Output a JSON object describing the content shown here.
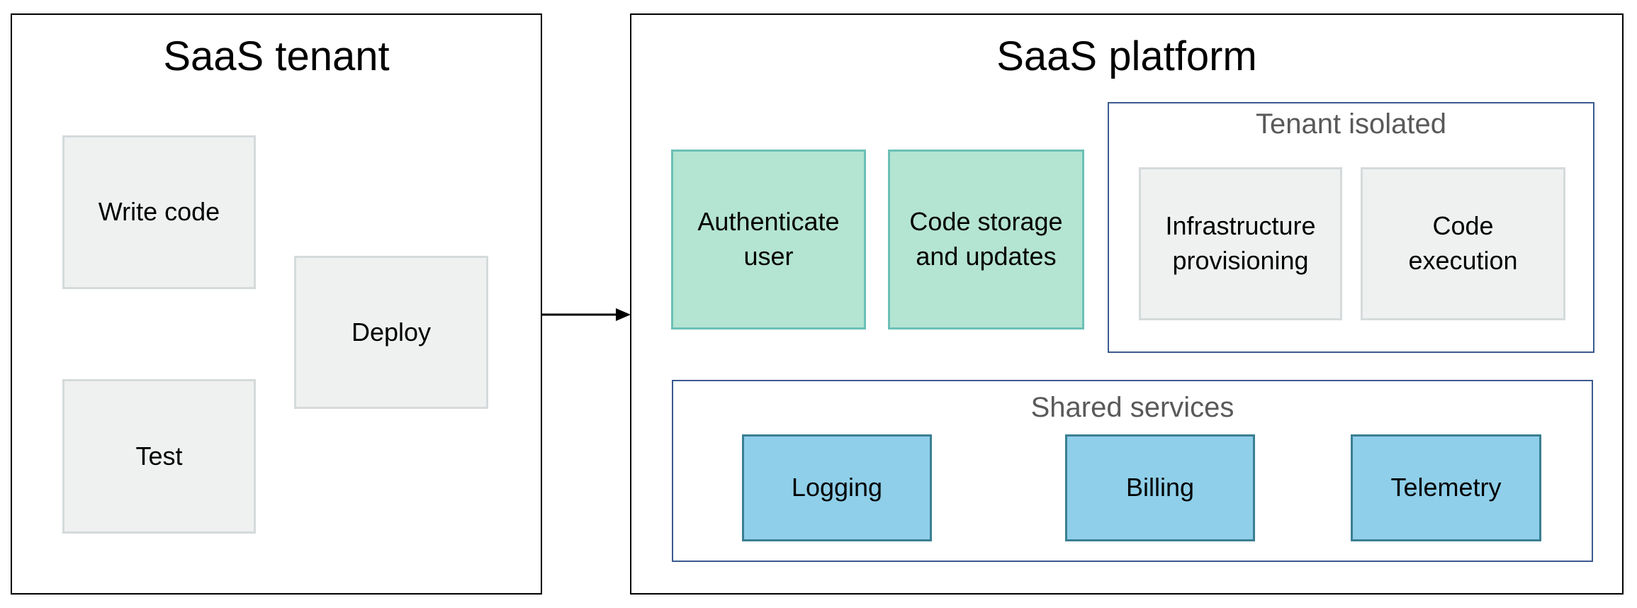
{
  "tenant": {
    "title": "SaaS tenant",
    "steps": [
      {
        "label": "Write code"
      },
      {
        "label": "Deploy"
      },
      {
        "label": "Test"
      }
    ]
  },
  "connector": {
    "type": "arrow",
    "direction": "tenant-to-platform"
  },
  "platform": {
    "title": "SaaS platform",
    "services": [
      {
        "label": "Authenticate\nuser"
      },
      {
        "label": "Code storage\nand updates"
      }
    ],
    "tenant_isolated": {
      "title": "Tenant isolated",
      "items": [
        {
          "label": "Infrastructure\nprovisioning"
        },
        {
          "label": "Code\nexecution"
        }
      ]
    },
    "shared_services": {
      "title": "Shared services",
      "items": [
        {
          "label": "Logging"
        },
        {
          "label": "Billing"
        },
        {
          "label": "Telemetry"
        }
      ]
    }
  },
  "colors": {
    "platform_service": "#b4e4d2",
    "shared_service": "#8fcfe9",
    "tenant_step": "#eff1f0",
    "group_border": "#3b5a8f"
  }
}
